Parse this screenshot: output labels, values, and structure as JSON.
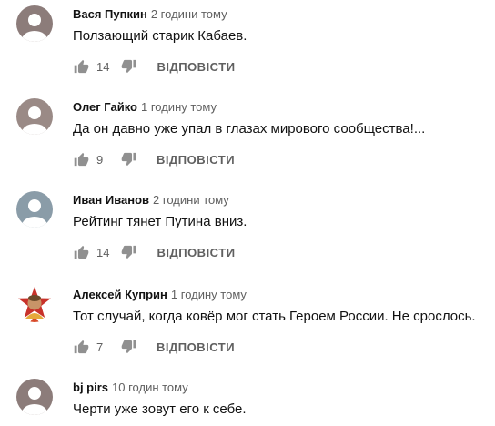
{
  "comments": [
    {
      "author": "Вася Пупкин",
      "time": "2 години тому",
      "text": "Ползающий старик Кабаев.",
      "likes": "14",
      "reply_label": "ВІДПОВІСТИ",
      "avatar_color": "#8c7c7a"
    },
    {
      "author": "Олег Гайко",
      "time": "1 годину тому",
      "text": "Да он давно уже упал в глазах мирового сообщества!...",
      "likes": "9",
      "reply_label": "ВІДПОВІСТИ",
      "avatar_color": "#9a8a86"
    },
    {
      "author": "Иван Иванов",
      "time": "2 години тому",
      "text": "Рейтинг тянет Путина вниз.",
      "likes": "14",
      "reply_label": "ВІДПОВІСТИ",
      "avatar_color": "#8a9ca8"
    },
    {
      "author": "Алексей Куприн",
      "time": "1 годину тому",
      "text": "Тот случай, когда ковёр мог стать Героем России. Не срослось.",
      "likes": "7",
      "reply_label": "ВІДПОВІСТИ",
      "avatar_color": "#c8322a"
    },
    {
      "author": "bj pirs",
      "time": "10 годин тому",
      "text": "Черти уже зовут его к себе.",
      "likes": "",
      "reply_label": "",
      "avatar_color": "#8c7c7a"
    }
  ],
  "colors": {
    "text": "#111111",
    "secondary": "#606060",
    "icon": "#909090"
  }
}
